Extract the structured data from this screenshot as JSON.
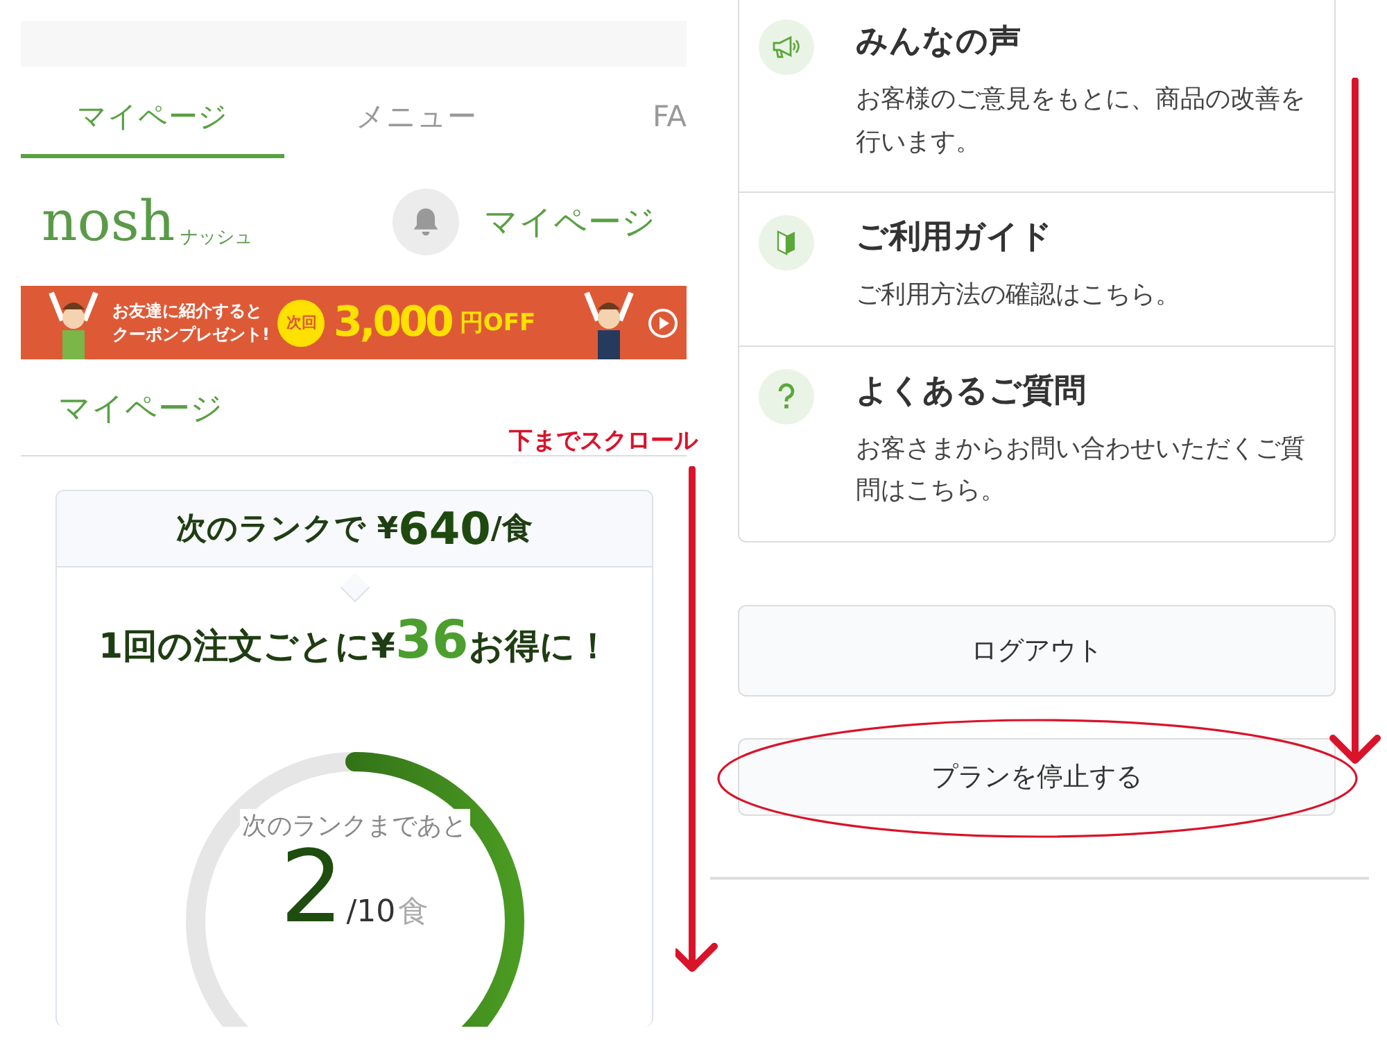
{
  "left_screen": {
    "tabs": [
      {
        "label": "マイページ",
        "selected": true
      },
      {
        "label": "メニュー",
        "selected": false
      },
      {
        "label": "FA",
        "selected": false
      }
    ],
    "header": {
      "logo": "nosh",
      "logo_kana": "ナッシュ",
      "page_title": "マイページ"
    },
    "banner": {
      "line_1": "お友達に紹介すると",
      "line_2": "クーポンプレゼント!",
      "badge": "次回",
      "amount": "3,000",
      "unit": "円OFF"
    },
    "section_title": "マイページ",
    "rank_card": {
      "header": "次のランクで ¥**640**/食",
      "savings": "1回の注文ごとに¥**36**お得に！",
      "gauge_caption": "次のランクまであと",
      "remaining": "2",
      "total": "/10",
      "unit": "食",
      "level": 0.4
    }
  },
  "right_screen": {
    "menu_items": [
      {
        "kind": "voice",
        "title": "みんなの声",
        "description": "お客様のご意見をもとに、商品の改善を行います。"
      },
      {
        "kind": "guide",
        "title": "ご利用ガイド",
        "description": "ご利用方法の確認はこちら。"
      },
      {
        "kind": "faq",
        "title": "よくあるご質問",
        "description": "お客さまからお問い合わせいただくご質問はこちら。"
      }
    ],
    "buttons": [
      {
        "label": "ログアウト",
        "circled": false
      },
      {
        "label": "プランを停止する",
        "circled": true
      }
    ]
  },
  "annotation": {
    "note": "下までスクロール"
  }
}
